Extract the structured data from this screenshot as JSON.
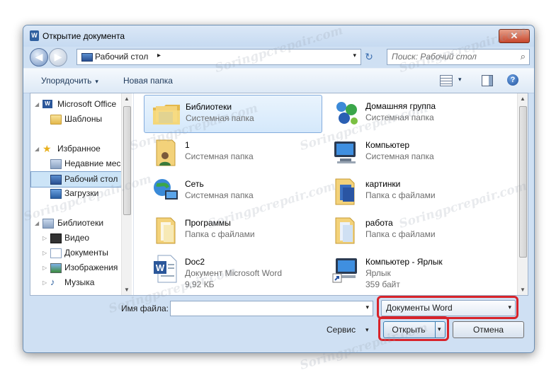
{
  "window": {
    "title": "Открытие документа",
    "title_icon_letter": "W",
    "close_glyph": "✕"
  },
  "nav": {
    "back_glyph": "◀",
    "forward_glyph": "▶",
    "refresh_glyph": "↻"
  },
  "address": {
    "path": "Рабочий стол",
    "separator": "▸",
    "dropdown": "▾"
  },
  "search": {
    "placeholder": "Поиск: Рабочий стол",
    "icon": "search-icon"
  },
  "toolbar": {
    "organize_label": "Упорядочить",
    "organize_caret": "▾",
    "new_folder_label": "Новая папка",
    "view_caret": "▾",
    "help_glyph": "?"
  },
  "sidebar": {
    "items": [
      {
        "label": "Microsoft Office",
        "icon": "word-icon"
      },
      {
        "label": "Шаблоны",
        "icon": "folder-icon"
      },
      {
        "label": "Избранное",
        "icon": "star-icon"
      },
      {
        "label": "Недавние мес",
        "icon": "recent-icon"
      },
      {
        "label": "Рабочий стол",
        "icon": "desktop-icon",
        "selected": true
      },
      {
        "label": "Загрузки",
        "icon": "downloads-icon"
      },
      {
        "label": "Библиотеки",
        "icon": "libraries-icon"
      },
      {
        "label": "Видео",
        "icon": "video-icon"
      },
      {
        "label": "Документы",
        "icon": "documents-icon"
      },
      {
        "label": "Изображения",
        "icon": "images-icon"
      },
      {
        "label": "Музыка",
        "icon": "music-icon"
      }
    ],
    "expanded_glyph": "◢",
    "collapsed_glyph": "▷"
  },
  "files": [
    {
      "name": "Библиотеки",
      "type": "Системная папка",
      "icon": "libraries-folder-icon",
      "selected": true
    },
    {
      "name": "Домашняя группа",
      "type": "Системная папка",
      "icon": "homegroup-icon"
    },
    {
      "name": "1",
      "type": "Системная папка",
      "icon": "user-folder-icon"
    },
    {
      "name": "Компьютер",
      "type": "Системная папка",
      "icon": "computer-icon"
    },
    {
      "name": "Сеть",
      "type": "Системная папка",
      "icon": "network-icon"
    },
    {
      "name": "картинки",
      "type": "Папка с файлами",
      "icon": "folder-icon"
    },
    {
      "name": "Программы",
      "type": "Папка с файлами",
      "icon": "folder-icon"
    },
    {
      "name": "работа",
      "type": "Папка с файлами",
      "icon": "folder-icon"
    },
    {
      "name": "Doc2",
      "type": "Документ Microsoft Word",
      "size": "9,92 КБ",
      "icon": "word-doc-icon"
    },
    {
      "name": "Компьютер - Ярлык",
      "type": "Ярлык",
      "size": "359 байт",
      "icon": "shortcut-icon"
    }
  ],
  "bottom": {
    "filename_label": "Имя файла:",
    "filename_value": "",
    "filetype_value": "Документы Word",
    "dropdown": "▾",
    "service_label": "Сервис",
    "open_label": "Открыть",
    "cancel_label": "Отмена"
  },
  "watermark": "Soringpcrepair.com",
  "colors": {
    "highlight": "#d8232a",
    "selection": "#cce4f7",
    "accent": "#3c7fb1"
  }
}
